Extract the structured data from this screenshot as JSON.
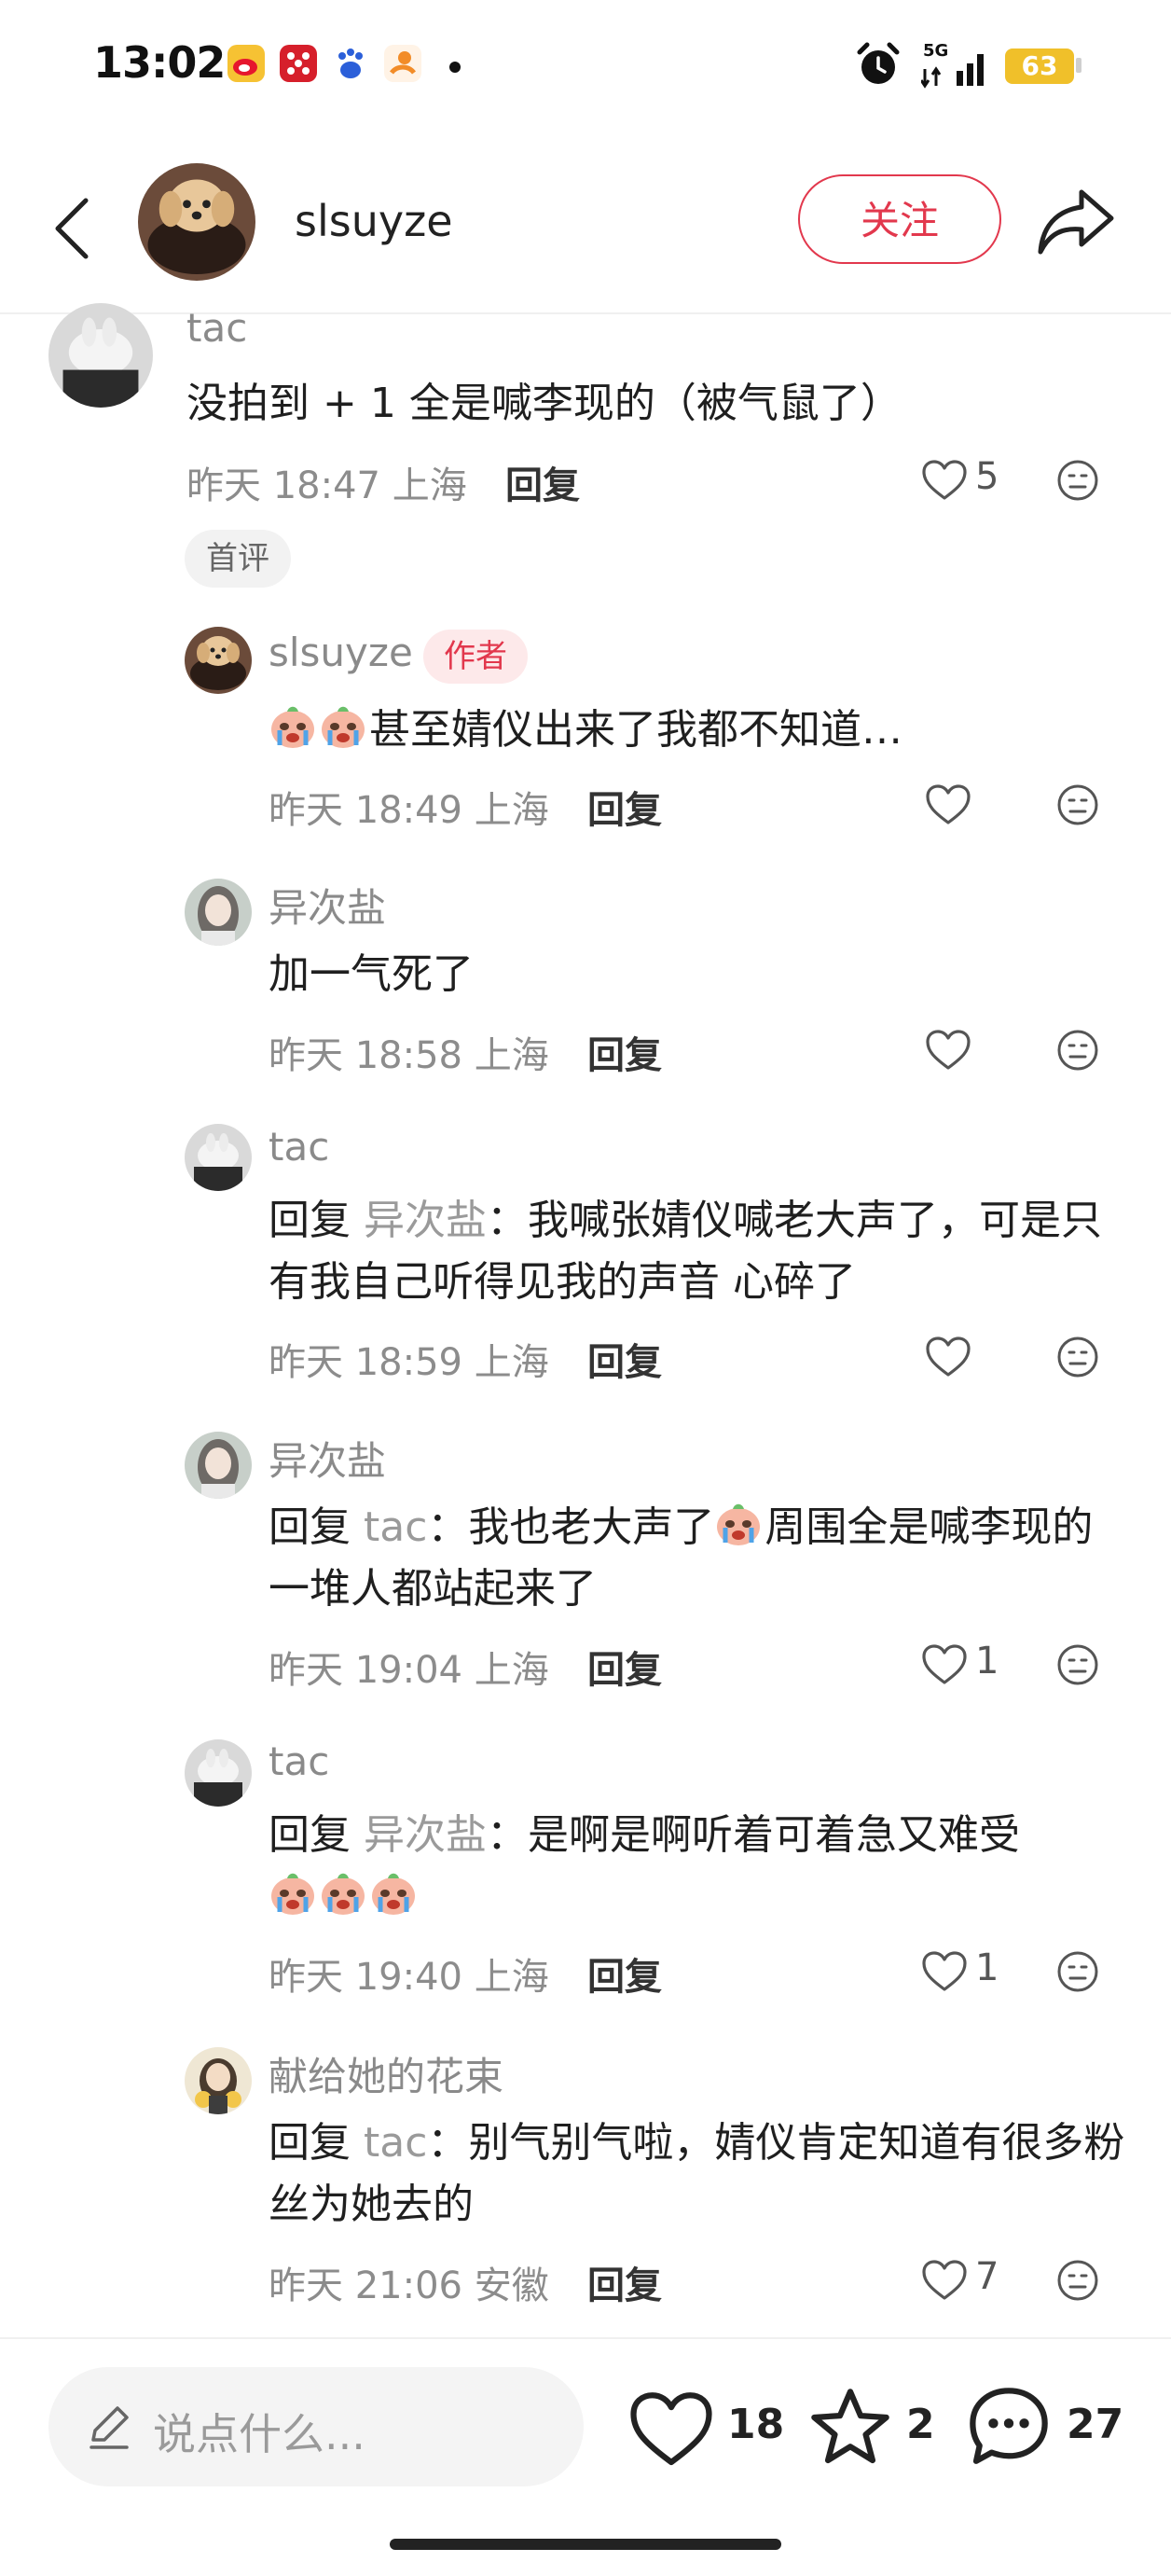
{
  "status_bar": {
    "time": "13:02",
    "network": "5G",
    "battery": "63",
    "app_icons": [
      "weibo-icon",
      "app-red-icon",
      "baidu-icon",
      "app-orange-icon"
    ]
  },
  "header": {
    "username": "slsuyze",
    "follow_label": "关注"
  },
  "comments": [
    {
      "name": "tac",
      "text": "没拍到 + 1 全是喊李现的（被气鼠了）",
      "meta": "昨天 18:47 上海",
      "reply_label": "回复",
      "likes": "5",
      "badge": "首评"
    },
    {
      "name": "slsuyze",
      "author_badge": "作者",
      "text": "甚至婧仪出来了我都不知道…",
      "meta": "昨天 18:49 上海",
      "reply_label": "回复",
      "likes": ""
    },
    {
      "name": "异次盐",
      "text": "加一气死了",
      "meta": "昨天 18:58 上海",
      "reply_label": "回复",
      "likes": ""
    },
    {
      "name": "tac",
      "reply_prefix": "回复",
      "reply_to": "异次盐",
      "text": "：我喊张婧仪喊老大声了，可是只有我自己听得见我的声音 心碎了",
      "meta": "昨天 18:59 上海",
      "reply_label": "回复",
      "likes": ""
    },
    {
      "name": "异次盐",
      "reply_prefix": "回复",
      "reply_to": "tac",
      "text_a": "：我也老大声了",
      "text_b": "周围全是喊李现的 一堆人都站起来了",
      "meta": "昨天 19:04 上海",
      "reply_label": "回复",
      "likes": "1"
    },
    {
      "name": "tac",
      "reply_prefix": "回复",
      "reply_to": "异次盐",
      "text": "：是啊是啊听着可着急又难受",
      "meta": "昨天 19:40 上海",
      "reply_label": "回复",
      "likes": "1"
    },
    {
      "name": "献给她的花束",
      "reply_prefix": "回复",
      "reply_to": "tac",
      "text": "：别气别气啦，婧仪肯定知道有很多粉丝为她去的",
      "meta": "昨天 21:06 安徽",
      "reply_label": "回复",
      "likes": "7"
    }
  ],
  "bottom_bar": {
    "input_placeholder": "说点什么...",
    "likes": "18",
    "stars": "2",
    "comments": "27"
  },
  "colors": {
    "accent": "#e2384d",
    "badge_bg": "#fde9ea",
    "battery": "#f0c02a",
    "meta_text": "#8c8c8c"
  }
}
